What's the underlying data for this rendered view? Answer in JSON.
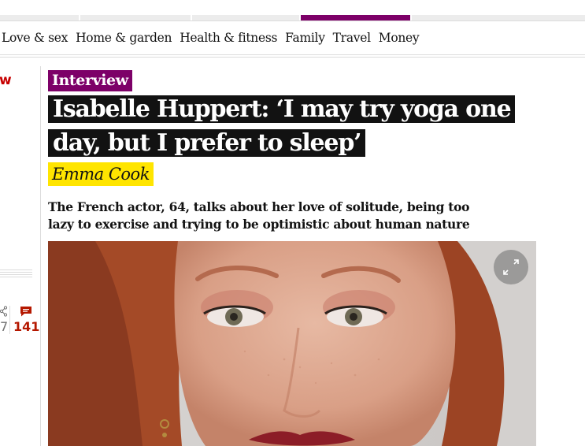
{
  "nav": {
    "items": [
      {
        "label": "Love & sex"
      },
      {
        "label": "Home & garden"
      },
      {
        "label": "Health & fitness"
      },
      {
        "label": "Family"
      },
      {
        "label": "Travel"
      },
      {
        "label": "Money"
      }
    ]
  },
  "left_rail": {
    "partial_label": "w",
    "share_count_partial": "7",
    "comment_count": "141"
  },
  "article": {
    "kicker": "Interview",
    "headline_line1": "Isabelle Huppert: ‘I may try yoga one",
    "headline_line2": "day, but I prefer to sleep’",
    "byline": "Emma Cook",
    "standfirst_line1": "The French actor, 64, talks about her love of solitude, being too",
    "standfirst_line2": "lazy to exercise and trying to be optimistic about human nature"
  },
  "colors": {
    "lifestyle_accent": "#7d0068",
    "headline_bg": "#121212",
    "byline_highlight": "#ffe500",
    "comment_red": "#b51800"
  },
  "icons": {
    "share": "share-icon",
    "comment": "comment-icon",
    "expand": "expand-icon"
  }
}
